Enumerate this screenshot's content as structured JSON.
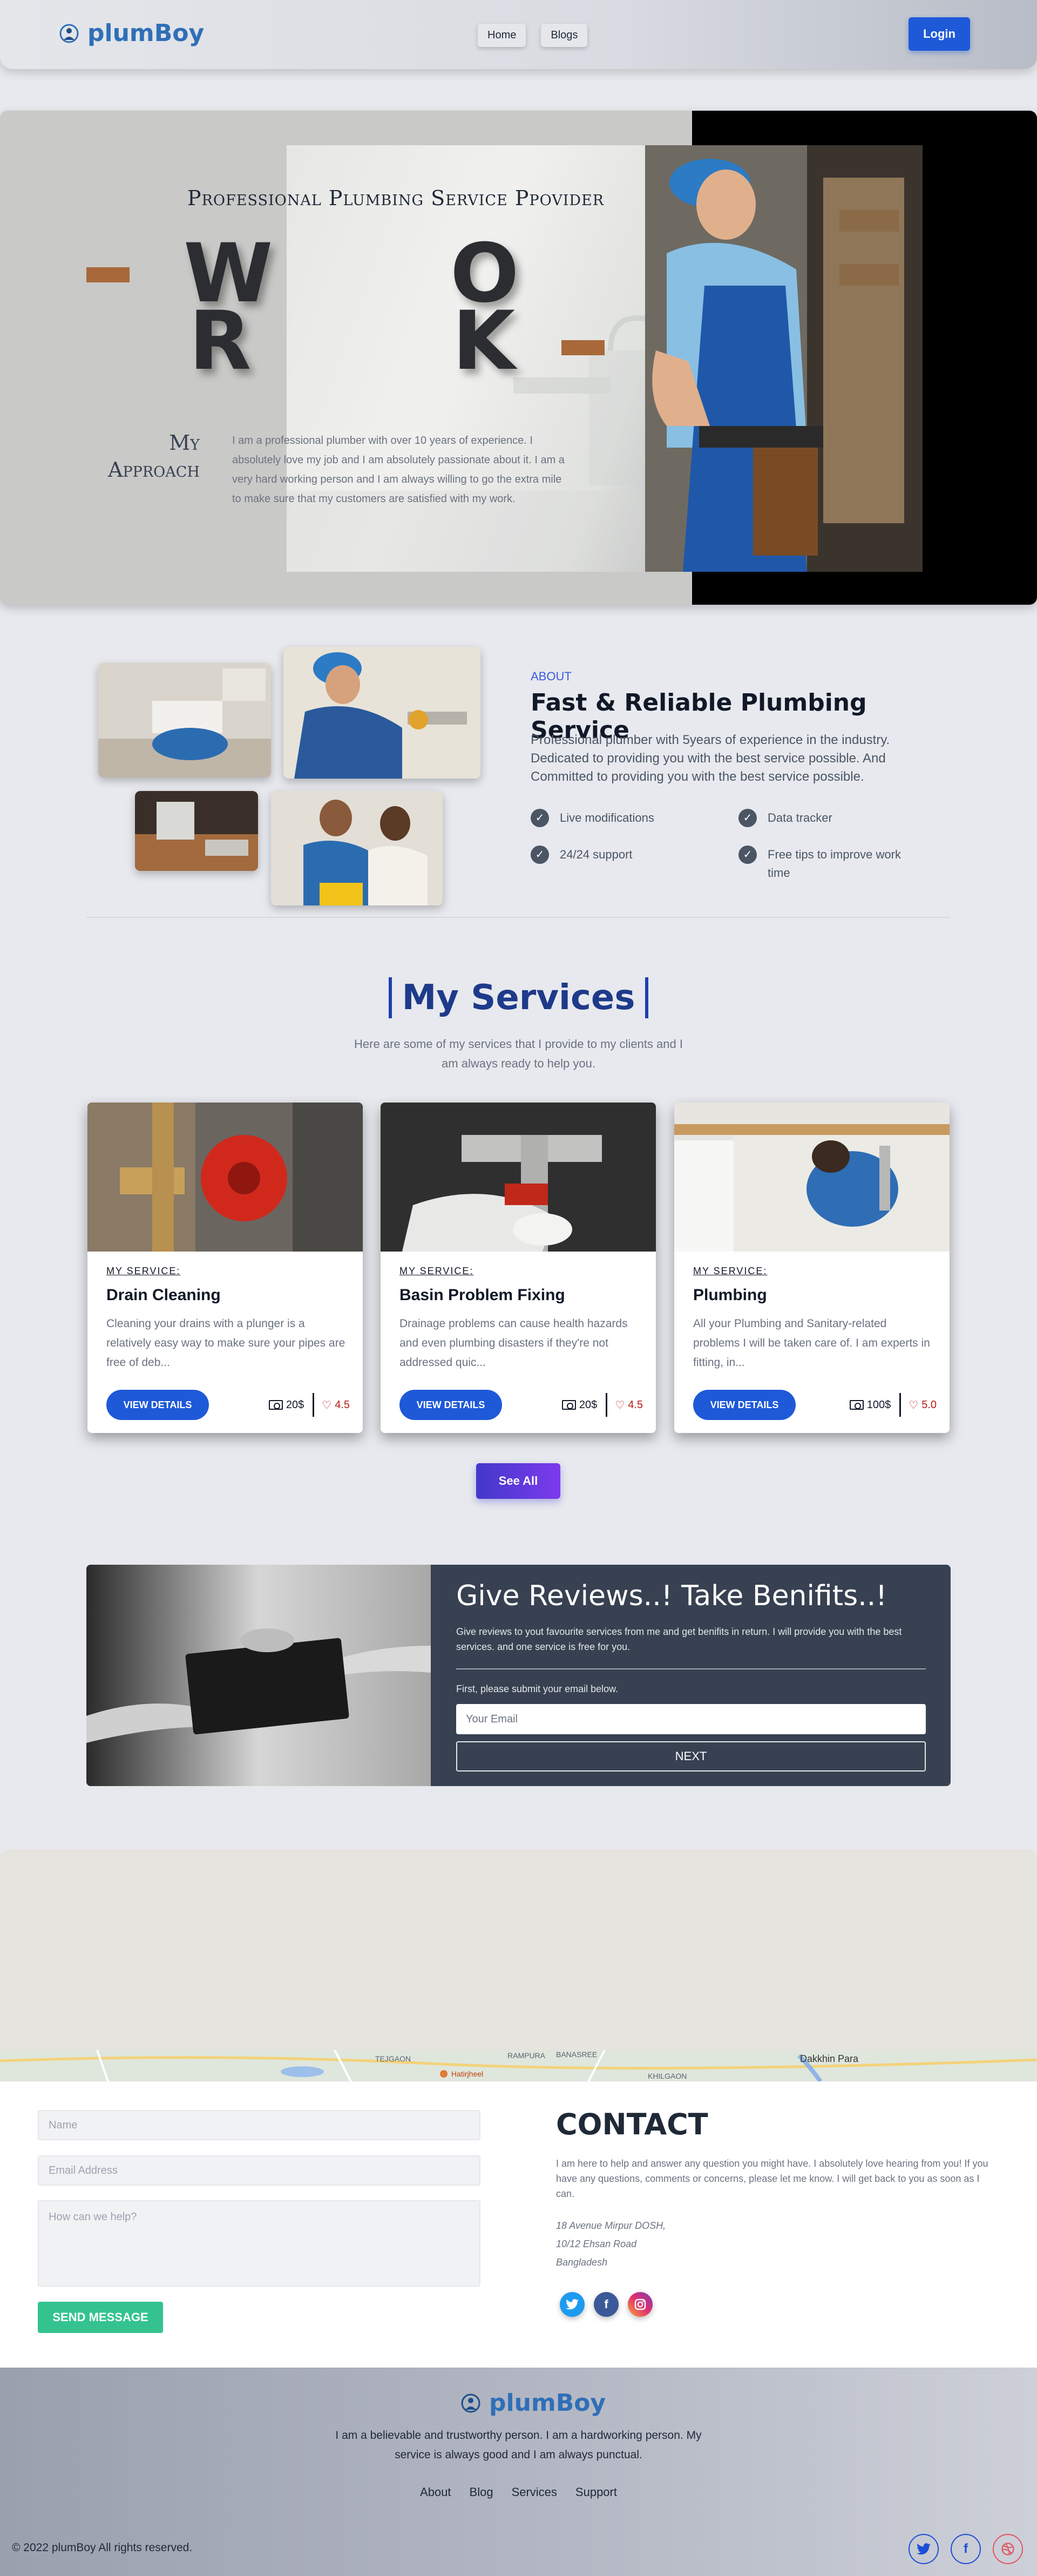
{
  "nav": {
    "brand": "plumBoy",
    "links": [
      "Home",
      "Blogs"
    ],
    "login": "Login"
  },
  "hero": {
    "eyebrow": "Professional Plumbing Service Ppovider",
    "letters": [
      "W",
      "O",
      "R",
      "K"
    ],
    "approach_line1": "My",
    "approach_line2": "Approach",
    "paragraph": "I am a professional plumber with over 10 years of experience. I absolutely love my job and I am absolutely passionate about it. I am a very hard working person and I am always willing to go the extra mile to make sure that my customers are satisfied with my work."
  },
  "about": {
    "eyebrow": "ABOUT",
    "title": "Fast & Reliable Plumbing Service",
    "description": "Professional plumber with 5years of experience in the industry. Dedicated to providing you with the best service possible. And Committed to providing you with the best service possible.",
    "features": [
      "Live modifications",
      "Data tracker",
      "24/24 support",
      "Free tips to improve work time"
    ]
  },
  "services": {
    "title": "My Services",
    "subtitle": "Here are some of my services that I provide to my clients and I am always ready to help you.",
    "cards": [
      {
        "eyebrow": "MY SERVICE:",
        "title": "Drain Cleaning",
        "desc": "Cleaning your drains with a plunger is a relatively easy way to make sure your pipes are free of deb...",
        "button": "VIEW DETAILS",
        "price": "20$",
        "rating": "4.5"
      },
      {
        "eyebrow": "MY SERVICE:",
        "title": "Basin Problem Fixing",
        "desc": "Drainage problems can cause health hazards and even plumbing disasters if they're not addressed quic...",
        "button": "VIEW DETAILS",
        "price": "20$",
        "rating": "4.5"
      },
      {
        "eyebrow": "MY SERVICE:",
        "title": "Plumbing",
        "desc": "All your Plumbing and Sanitary-related problems I will be taken care of. I am experts in fitting, in...",
        "button": "VIEW DETAILS",
        "price": "100$",
        "rating": "5.0"
      }
    ],
    "see_all": "See All"
  },
  "review": {
    "title": "Give Reviews..! Take Benifits..!",
    "description": "Give reviews to yout favourite services from me and get benifits in return. I will provide you with the best services. and one service is free for you.",
    "label": "First, please submit your email below.",
    "email_placeholder": "Your Email",
    "next": "NEXT"
  },
  "map": {
    "labels": [
      "TEJGAON",
      "RAMPURA",
      "BANASREE",
      "Dakkhin Para",
      "Hatirjheel",
      "KHILGAON"
    ]
  },
  "contact": {
    "name_placeholder": "Name",
    "email_placeholder": "Email Address",
    "message_placeholder": "How can we help?",
    "send": "SEND MESSAGE",
    "title": "CONTACT",
    "description": "I am here to help and answer any question you might have. I absolutely love hearing from you! If you have any questions, comments or concerns, please let me know. I will get back to you as soon as I can.",
    "address": [
      "18 Avenue Mirpur DOSH,",
      "10/12 Ehsan Road",
      "Bangladesh"
    ]
  },
  "footer": {
    "brand": "plumBoy",
    "description": "I am a believable and trustworthy person. I am a hardworking person. My service is always good and I am always punctual.",
    "links": [
      "About",
      "Blog",
      "Services",
      "Support"
    ],
    "copyright": "© 2022 plumBoy All rights reserved."
  },
  "colors": {
    "primary": "#1e59d8",
    "brand": "#2f6fb8",
    "accent_bar": "#a8683a",
    "success": "#34c38f",
    "review_bg": "#374151"
  },
  "icons": [
    "plumbing-logo-icon",
    "check-circle-icon",
    "money-icon",
    "heart-icon",
    "twitter-icon",
    "facebook-icon",
    "dribbble-icon"
  ]
}
